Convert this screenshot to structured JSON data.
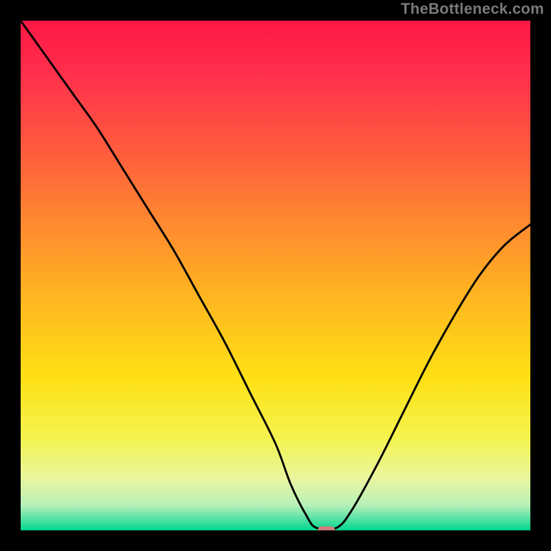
{
  "watermark": "TheBottleneck.com",
  "chart_data": {
    "type": "line",
    "title": "",
    "xlabel": "",
    "ylabel": "",
    "xlim": [
      0,
      100
    ],
    "ylim": [
      0,
      100
    ],
    "x": [
      0,
      5,
      10,
      15,
      20,
      25,
      30,
      35,
      40,
      45,
      50,
      53,
      56,
      58,
      62,
      65,
      70,
      75,
      80,
      85,
      90,
      95,
      100
    ],
    "values": [
      100,
      93,
      86,
      79,
      71,
      63,
      55,
      46,
      37,
      27,
      17,
      9,
      3,
      0.5,
      0.5,
      4,
      13,
      23,
      33,
      42,
      50,
      56,
      60
    ],
    "marker": {
      "x": 60,
      "y": 0,
      "w": 3.4,
      "h": 1.6,
      "color": "#cf7f7c"
    },
    "gradient_stops": [
      {
        "offset": 0.0,
        "color": "#ff1744"
      },
      {
        "offset": 0.1,
        "color": "#ff2e4c"
      },
      {
        "offset": 0.25,
        "color": "#ff5a3e"
      },
      {
        "offset": 0.4,
        "color": "#ff8a2f"
      },
      {
        "offset": 0.55,
        "color": "#ffb820"
      },
      {
        "offset": 0.7,
        "color": "#ffe015"
      },
      {
        "offset": 0.82,
        "color": "#f4f450"
      },
      {
        "offset": 0.9,
        "color": "#e9f6a0"
      },
      {
        "offset": 0.95,
        "color": "#b8f0b8"
      },
      {
        "offset": 0.975,
        "color": "#5fe3a6"
      },
      {
        "offset": 1.0,
        "color": "#00d68f"
      }
    ],
    "curve_color": "#000000",
    "curve_width": 3
  }
}
